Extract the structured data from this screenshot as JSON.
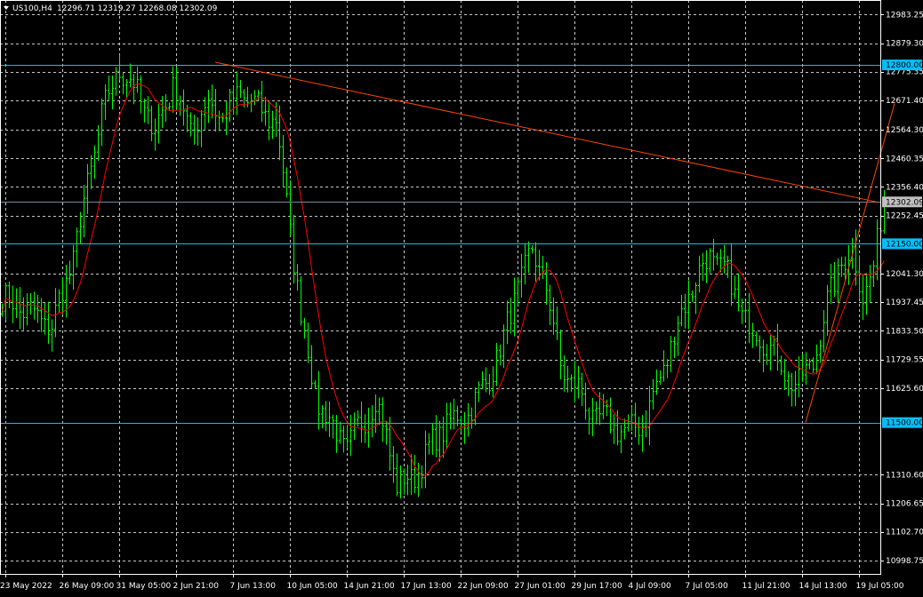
{
  "header": {
    "symbol": "US100,H4",
    "ohlc": "12296.71 12319.27 12268.08 12302.09"
  },
  "colors": {
    "background": "#000000",
    "grid": "#c8c8c8",
    "bars": "#00ff00",
    "moving_average": "#ff0000",
    "trendline": "#ff4500",
    "level_lines": "#00c0ff",
    "bid_line": "#778899",
    "axis_text": "#ffffff",
    "level_label_bg": "#00c0ff",
    "price_label_bg": "#c0c0c0"
  },
  "chart_data": {
    "type": "ohlc",
    "symbol": "US100",
    "timeframe": "H4",
    "grid": true,
    "ylim": [
      10950.0,
      13036.0
    ],
    "y_ticks": [
      "12983.25",
      "12879.30",
      "12775.35",
      "12671.40",
      "12564.30",
      "12460.35",
      "12356.40",
      "12252.45",
      "12041.30",
      "11937.45",
      "11833.50",
      "11729.55",
      "11625.60",
      "11310.60",
      "11206.65",
      "11102.70",
      "10998.75"
    ],
    "x_ticks": [
      "23 May 2022",
      "26 May 09:00",
      "31 May 05:00",
      "2 Jun 21:00",
      "7 Jun 13:00",
      "10 Jun 05:00",
      "14 Jun 21:00",
      "17 Jun 13:00",
      "22 Jun 09:00",
      "27 Jun 01:00",
      "29 Jun 17:00",
      "4 Jul 09:00",
      "7 Jul 05:00",
      "11 Jul 21:00",
      "14 Jul 13:00",
      "19 Jul 05:00"
    ],
    "horizontal_levels": [
      {
        "price": 12800.0,
        "label": "12800.00"
      },
      {
        "price": 12150.0,
        "label": "12150.00"
      },
      {
        "price": 11500.0,
        "label": "11500.00"
      }
    ],
    "current_price": {
      "price": 12302.09,
      "label": "12302.09"
    },
    "trendlines": [
      {
        "points": [
          {
            "bar": 60,
            "price": 12810
          },
          {
            "bar": 246,
            "price": 12302
          }
        ]
      },
      {
        "points": [
          {
            "bar": 226,
            "price": 11500
          },
          {
            "bar": 251,
            "price": 12660
          }
        ]
      }
    ],
    "close_path": [
      [
        0,
        11950
      ],
      [
        8,
        11900
      ],
      [
        14,
        11850
      ],
      [
        20,
        12100
      ],
      [
        28,
        12620
      ],
      [
        33,
        12790
      ],
      [
        38,
        12700
      ],
      [
        43,
        12560
      ],
      [
        48,
        12730
      ],
      [
        53,
        12560
      ],
      [
        58,
        12670
      ],
      [
        62,
        12610
      ],
      [
        67,
        12700
      ],
      [
        72,
        12640
      ],
      [
        77,
        12600
      ],
      [
        81,
        12200
      ],
      [
        84,
        11900
      ],
      [
        88,
        11600
      ],
      [
        93,
        11480
      ],
      [
        97,
        11410
      ],
      [
        101,
        11500
      ],
      [
        105,
        11580
      ],
      [
        108,
        11450
      ],
      [
        111,
        11280
      ],
      [
        115,
        11290
      ],
      [
        120,
        11400
      ],
      [
        125,
        11500
      ],
      [
        130,
        11520
      ],
      [
        136,
        11640
      ],
      [
        141,
        11800
      ],
      [
        145,
        12000
      ],
      [
        149,
        12120
      ],
      [
        153,
        12000
      ],
      [
        157,
        11700
      ],
      [
        162,
        11620
      ],
      [
        166,
        11520
      ],
      [
        171,
        11500
      ],
      [
        176,
        11460
      ],
      [
        181,
        11520
      ],
      [
        186,
        11700
      ],
      [
        190,
        11860
      ],
      [
        195,
        12030
      ],
      [
        199,
        12100
      ],
      [
        203,
        12060
      ],
      [
        207,
        11930
      ],
      [
        211,
        11830
      ],
      [
        216,
        11780
      ],
      [
        220,
        11680
      ],
      [
        224,
        11640
      ],
      [
        228,
        11720
      ],
      [
        232,
        11930
      ],
      [
        236,
        12090
      ],
      [
        239,
        12110
      ],
      [
        242,
        11970
      ],
      [
        245,
        12060
      ],
      [
        248,
        12302
      ]
    ],
    "volatility": 45,
    "seed": 7,
    "ma_period": 10
  }
}
